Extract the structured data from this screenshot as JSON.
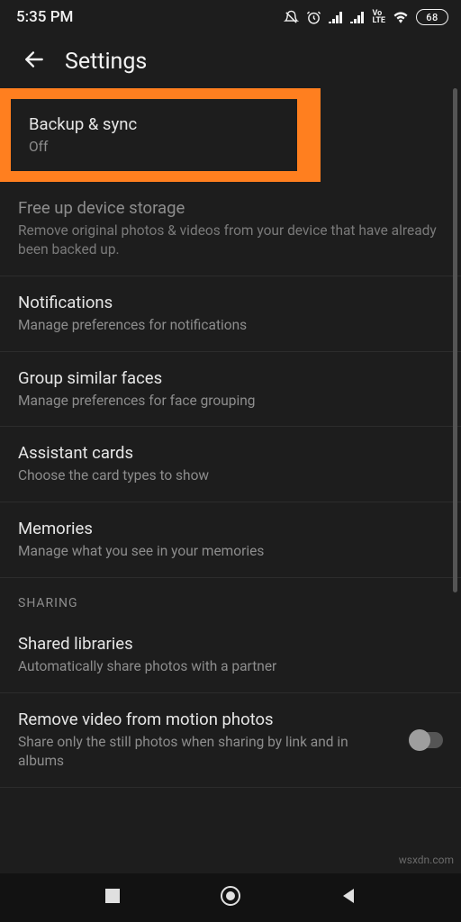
{
  "status": {
    "time": "5:35 PM",
    "battery": "68"
  },
  "header": {
    "title": "Settings"
  },
  "items": {
    "backup": {
      "title": "Backup & sync",
      "sub": "Off"
    },
    "freeup": {
      "title": "Free up device storage",
      "sub": "Remove original photos & videos from your device that have already been backed up."
    },
    "notifications": {
      "title": "Notifications",
      "sub": "Manage preferences for notifications"
    },
    "faces": {
      "title": "Group similar faces",
      "sub": "Manage preferences for face grouping"
    },
    "assistant": {
      "title": "Assistant cards",
      "sub": "Choose the card types to show"
    },
    "memories": {
      "title": "Memories",
      "sub": "Manage what you see in your memories"
    },
    "shared_libs": {
      "title": "Shared libraries",
      "sub": "Automatically share photos with a partner"
    },
    "remove_video": {
      "title": "Remove video from motion photos",
      "sub": "Share only the still photos when sharing by link and in albums"
    }
  },
  "sections": {
    "sharing": "SHARING"
  },
  "watermark": "wsxdn.com"
}
